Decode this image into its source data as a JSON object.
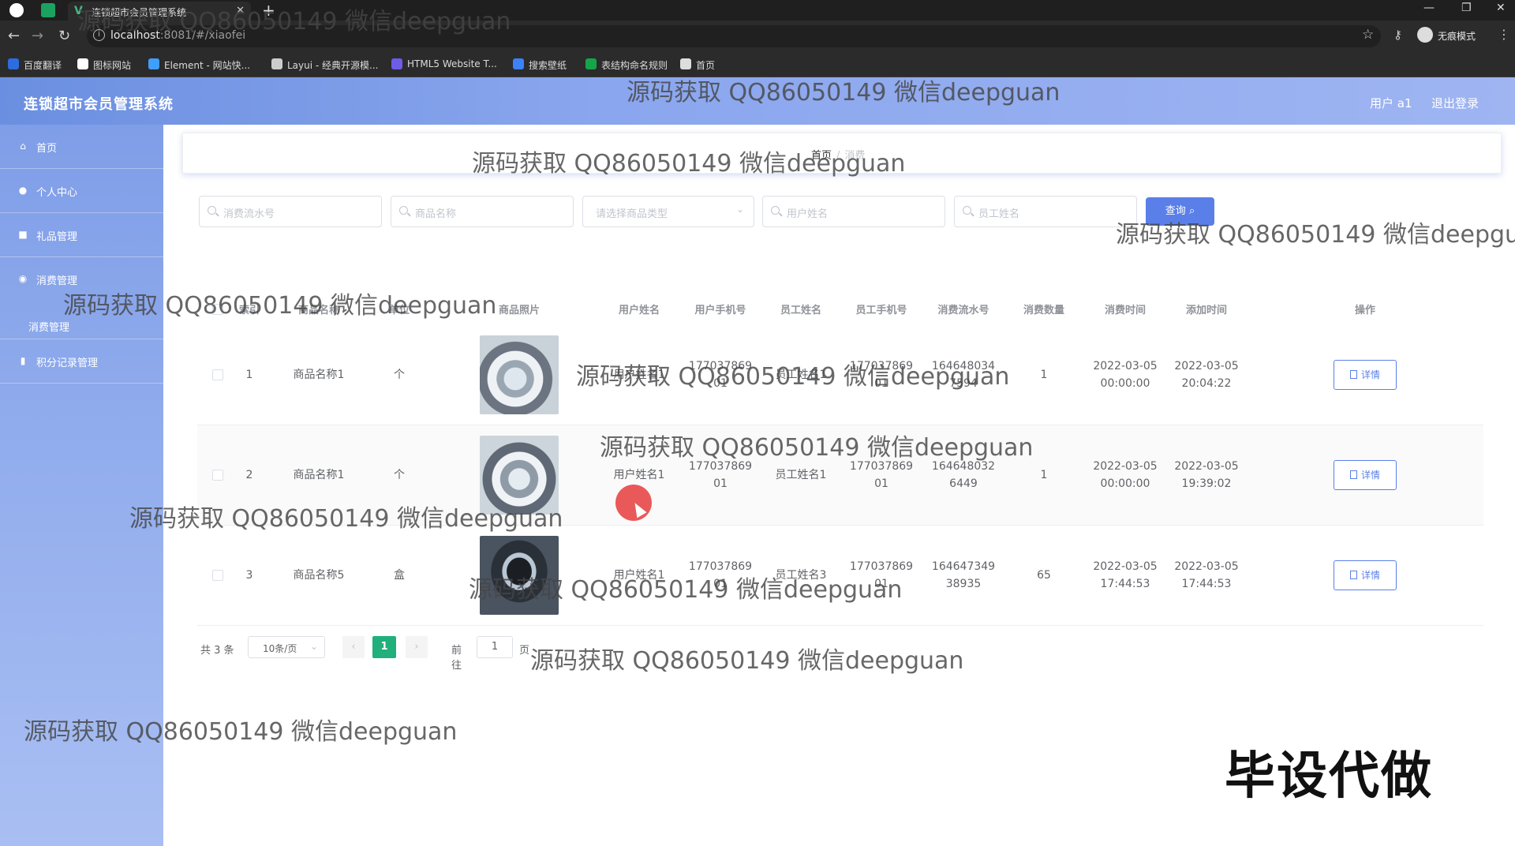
{
  "browser": {
    "tab_title": "连锁超市会员管理系统",
    "url_host": "localhost",
    "url_rest": ":8081/#/xiaofei",
    "profile_label": "无痕模式",
    "bookmarks": [
      {
        "label": "百度翻译",
        "color": "#2d6cdf"
      },
      {
        "label": "图标网站",
        "color": "#ffffff"
      },
      {
        "label": "Element - 网站快...",
        "color": "#409eff"
      },
      {
        "label": "Layui - 经典开源模...",
        "color": "#cccccc"
      },
      {
        "label": "HTML5 Website T...",
        "color": "#6c5ce7"
      },
      {
        "label": "搜索壁纸",
        "color": "#3b82f6"
      },
      {
        "label": "表结构命名规则",
        "color": "#16a34a"
      },
      {
        "label": "首页",
        "color": "#dddddd"
      }
    ]
  },
  "header": {
    "title": "连锁超市会员管理系统",
    "user": "用户 a1",
    "logout": "退出登录"
  },
  "sidebar": {
    "items": [
      {
        "label": "首页",
        "icon": "home-icon"
      },
      {
        "label": "个人中心",
        "icon": "user-icon"
      },
      {
        "label": "礼品管理",
        "icon": "gift-icon"
      },
      {
        "label": "消费管理",
        "icon": "cart-icon"
      },
      {
        "label": "积分记录管理",
        "icon": "chart-icon"
      }
    ],
    "sub_item": "消费管理"
  },
  "breadcrumb": {
    "home": "首页",
    "current": "消费"
  },
  "search": {
    "serial_placeholder": "消费流水号",
    "product_placeholder": "商品名称",
    "type_placeholder": "请选择商品类型",
    "user_placeholder": "用户姓名",
    "staff_placeholder": "员工姓名",
    "button": "查询"
  },
  "table": {
    "headers": [
      "索引",
      "商品名称",
      "单位",
      "商品照片",
      "用户姓名",
      "用户手机号",
      "员工姓名",
      "员工手机号",
      "消费流水号",
      "消费数量",
      "消费时间",
      "添加时间",
      "操作"
    ],
    "rows": [
      {
        "index": "1",
        "product": "商品名称1",
        "unit": "个",
        "user": "用户姓名1",
        "user_phone_1": "177037869",
        "user_phone_2": "01",
        "staff": "员工姓名1",
        "staff_phone_1": "177037869",
        "staff_phone_2": "01",
        "serial_1": "164648034",
        "serial_2": "7594",
        "qty": "1",
        "time_1": "2022-03-05",
        "time_2": "00:00:00",
        "added_1": "2022-03-05",
        "added_2": "20:04:22",
        "action": "详情"
      },
      {
        "index": "2",
        "product": "商品名称1",
        "unit": "个",
        "user": "用户姓名1",
        "user_phone_1": "177037869",
        "user_phone_2": "01",
        "staff": "员工姓名1",
        "staff_phone_1": "177037869",
        "staff_phone_2": "01",
        "serial_1": "164648032",
        "serial_2": "6449",
        "qty": "1",
        "time_1": "2022-03-05",
        "time_2": "00:00:00",
        "added_1": "2022-03-05",
        "added_2": "19:39:02",
        "action": "详情"
      },
      {
        "index": "3",
        "product": "商品名称5",
        "unit": "盒",
        "user": "用户姓名1",
        "user_phone_1": "177037869",
        "user_phone_2": "01",
        "staff": "员工姓名3",
        "staff_phone_1": "177037869",
        "staff_phone_2": "01",
        "serial_1": "164647349",
        "serial_2": "38935",
        "qty": "65",
        "time_1": "2022-03-05",
        "time_2": "17:44:53",
        "added_1": "2022-03-05",
        "added_2": "17:44:53",
        "action": "详情"
      }
    ]
  },
  "pagination": {
    "total": "共 3 条",
    "page_size": "10条/页",
    "current": "1",
    "goto_label": "前往",
    "goto_value": "1",
    "unit": "页"
  },
  "watermark": "源码获取 QQ86050149 微信deepguan",
  "stamp": "毕设代做",
  "colors": {
    "primary": "#5b7fe8",
    "pager_active": "#21b07b"
  }
}
